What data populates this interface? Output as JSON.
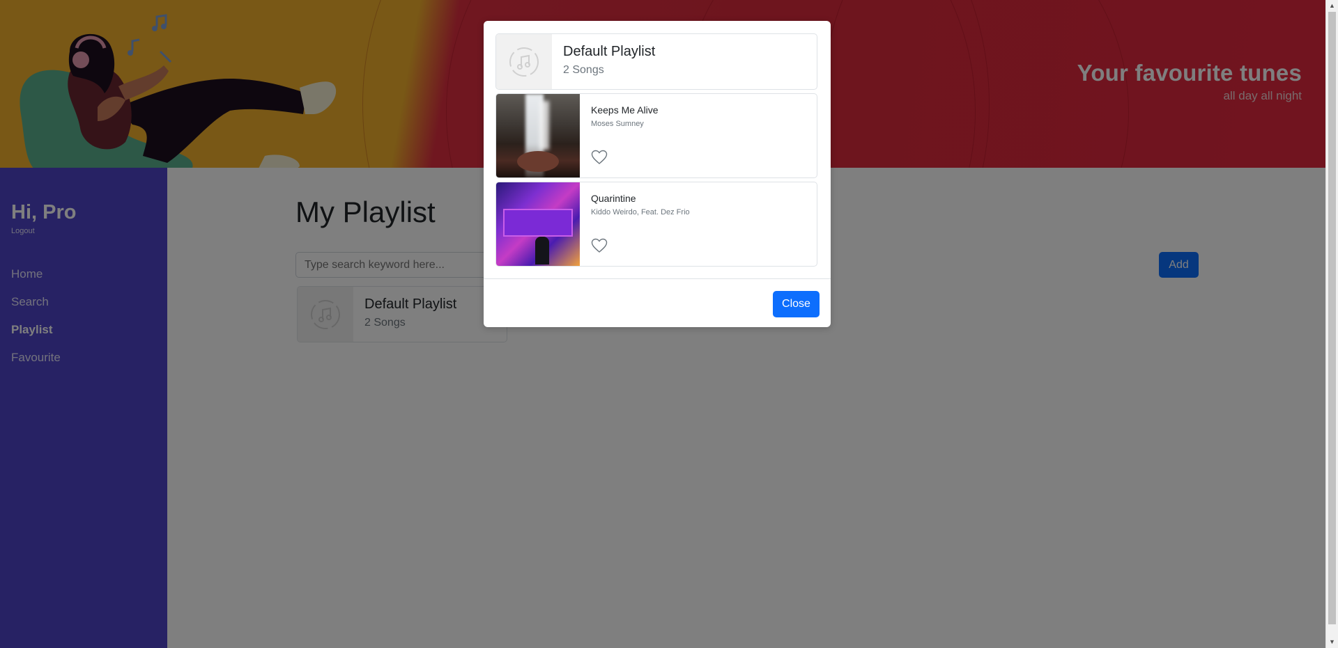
{
  "banner": {
    "title": "Your favourite tunes",
    "subtitle": "all day all night"
  },
  "sidebar": {
    "greeting": "Hi, Pro",
    "logout": "Logout",
    "items": [
      {
        "label": "Home",
        "icon": "home"
      },
      {
        "label": "Search",
        "icon": "search"
      },
      {
        "label": "Playlist",
        "icon": "playlist",
        "active": true
      },
      {
        "label": "Favourite",
        "icon": "favourite"
      }
    ]
  },
  "main": {
    "title": "My Playlist",
    "search_placeholder": "Type search keyword here...",
    "add_label": "Add",
    "playlist": {
      "name": "Default Playlist",
      "count": "2 Songs"
    }
  },
  "modal": {
    "playlist_name": "Default Playlist",
    "playlist_count": "2 Songs",
    "songs": [
      {
        "title": "Keeps Me Alive",
        "artist": "Moses Sumney",
        "art": "waterfall-cover",
        "favourite": false
      },
      {
        "title": "Quarintine",
        "artist": "Kiddo Weirdo, Feat. Dez Frio",
        "art": "quarintine-cover",
        "favourite": false
      }
    ],
    "close_label": "Close"
  },
  "colors": {
    "sidebar": "#4e44c8",
    "banner_red": "#dc2a3c",
    "banner_yellow": "#f2b12c",
    "primary": "#0d6efd"
  }
}
